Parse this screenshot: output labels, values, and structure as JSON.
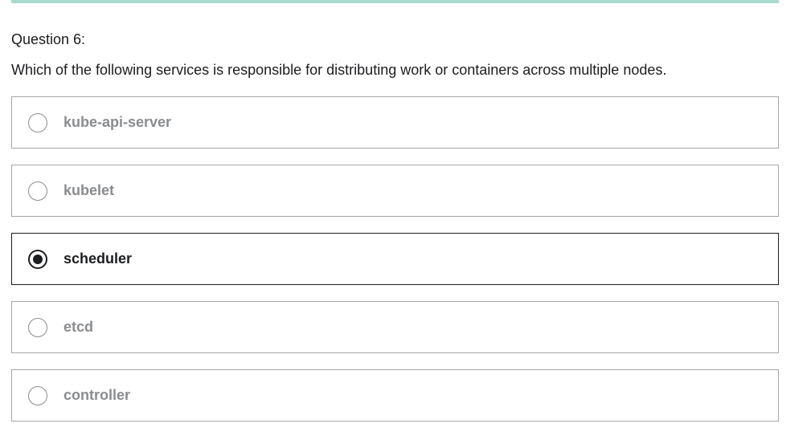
{
  "question": {
    "number_label": "Question 6:",
    "text": "Which of the following services is responsible for distributing work or containers across multiple nodes."
  },
  "answers": [
    {
      "label": "kube-api-server",
      "selected": false
    },
    {
      "label": "kubelet",
      "selected": false
    },
    {
      "label": "scheduler",
      "selected": true
    },
    {
      "label": "etcd",
      "selected": false
    },
    {
      "label": "controller",
      "selected": false
    }
  ],
  "colors": {
    "accent_bar": "#a9d9cf",
    "text_dark": "#1c1d1f",
    "text_muted": "#8a8c8f",
    "border": "#a3a5a7"
  }
}
